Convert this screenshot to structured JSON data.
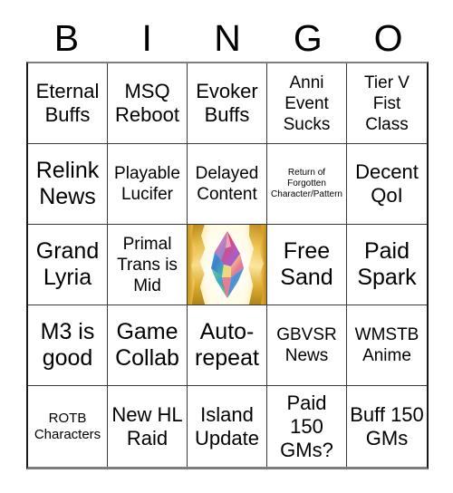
{
  "header": {
    "letters": [
      "B",
      "I",
      "N",
      "G",
      "O"
    ]
  },
  "grid": {
    "rows": 5,
    "columns": 5,
    "cells": [
      {
        "text": "Eternal Buffs",
        "size": "lg",
        "type": "text"
      },
      {
        "text": "MSQ Reboot",
        "size": "lg",
        "type": "text"
      },
      {
        "text": "Evoker Buffs",
        "size": "lg",
        "type": "text"
      },
      {
        "text": "Anni Event Sucks",
        "size": "md",
        "type": "text"
      },
      {
        "text": "Tier V Fist Class",
        "size": "md",
        "type": "text"
      },
      {
        "text": "Relink News",
        "size": "xl",
        "type": "text"
      },
      {
        "text": "Playable Lucifer",
        "size": "md",
        "type": "text"
      },
      {
        "text": "Delayed Content",
        "size": "md",
        "type": "text"
      },
      {
        "text": "Return of Forgotten Character/Pattern",
        "size": "xs",
        "type": "text"
      },
      {
        "text": "Decent QoI",
        "size": "lg",
        "type": "text"
      },
      {
        "text": "Grand Lyria",
        "size": "xl",
        "type": "text"
      },
      {
        "text": "Primal Trans is Mid",
        "size": "md",
        "type": "text"
      },
      {
        "text": "",
        "size": "md",
        "type": "image",
        "image_name": "free-space-crystal-art"
      },
      {
        "text": "Free Sand",
        "size": "xl",
        "type": "text"
      },
      {
        "text": "Paid Spark",
        "size": "xl",
        "type": "text"
      },
      {
        "text": "M3 is good",
        "size": "xl",
        "type": "text"
      },
      {
        "text": "Game Collab",
        "size": "xl",
        "type": "text"
      },
      {
        "text": "Auto-repeat",
        "size": "xl",
        "type": "text"
      },
      {
        "text": "GBVSR News",
        "size": "md",
        "type": "text"
      },
      {
        "text": "WMSTB Anime",
        "size": "md",
        "type": "text"
      },
      {
        "text": "ROTB Characters",
        "size": "sm",
        "type": "text"
      },
      {
        "text": "New HL Raid",
        "size": "lg",
        "type": "text"
      },
      {
        "text": "Island Update",
        "size": "lg",
        "type": "text"
      },
      {
        "text": "Paid 150 GMs?",
        "size": "lg",
        "type": "text"
      },
      {
        "text": "Buff 150 GMs",
        "size": "lg",
        "type": "text"
      }
    ]
  },
  "colors": {
    "background": "#ffffff",
    "text": "#000000",
    "grid_line": "#3a3a3a",
    "grid_outer": "#7d7d7d",
    "free_space_gold": "#d9a92c"
  }
}
